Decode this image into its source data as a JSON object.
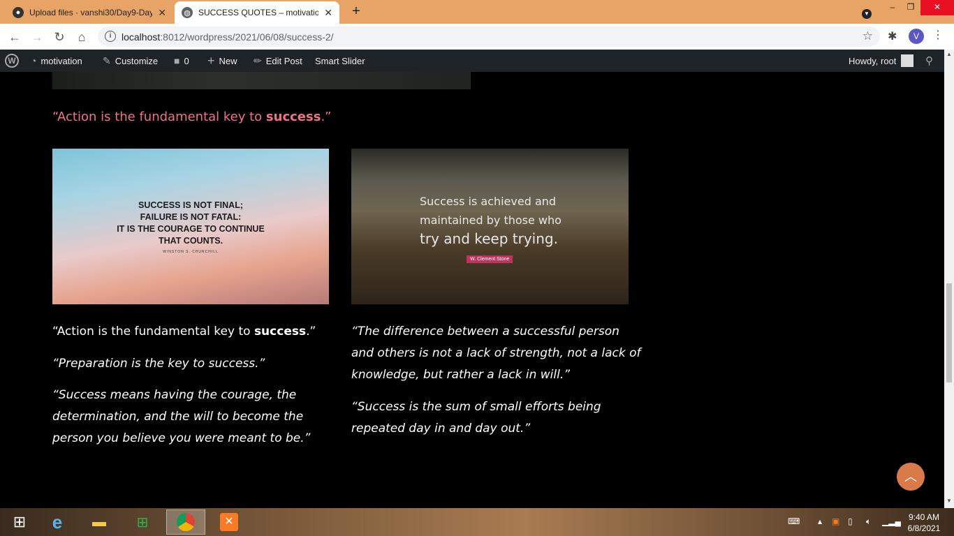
{
  "browser": {
    "tabs": [
      {
        "title": "Upload files · vanshi30/Day9-Day",
        "active": false,
        "icon": "github-icon"
      },
      {
        "title": "SUCCESS QUOTES – motivation",
        "active": true,
        "icon": "globe-icon"
      }
    ],
    "url_host": "localhost",
    "url_path": ":8012/wordpress/2021/06/08/success-2/",
    "profile_initial": "V"
  },
  "wp_admin_bar": {
    "site": "motivation",
    "customize": "Customize",
    "comments": "0",
    "new": "New",
    "edit_post": "Edit Post",
    "smart_slider": "Smart Slider",
    "howdy": "Howdy, root"
  },
  "post": {
    "pink_quote_pre": "“Action is the fundamental key to ",
    "pink_quote_bold": "success",
    "pink_quote_post": ".”",
    "image1": {
      "quote_lines": [
        "SUCCESS IS NOT FINAL;",
        "FAILURE IS NOT FATAL:",
        "IT IS THE COURAGE TO CONTINUE",
        "THAT COUNTS."
      ],
      "author": "WINSTON S. CHURCHILL"
    },
    "image2": {
      "quote_lines": [
        "Success is achieved and",
        "maintained by those who",
        "try and keep trying."
      ],
      "author": "W. Clement Stone"
    },
    "left_col": {
      "q1_pre": "“Action is the fundamental key to ",
      "q1_bold": "success",
      "q1_post": ".”",
      "q2": "“Preparation is the key to success.”",
      "q3_lines": [
        "“Success means having the courage, the",
        "determination, and the will to become the",
        "person you believe you were meant to be.”"
      ]
    },
    "right_col": {
      "q1_lines": [
        "“The difference between a successful person",
        "and others is not a lack of strength, not a lack of",
        "knowledge, but rather a lack in will.”"
      ],
      "q2_lines": [
        "“Success is the sum of small efforts being",
        "repeated day in and day out.”"
      ]
    }
  },
  "taskbar": {
    "time": "9:40 AM",
    "date": "6/8/2021"
  },
  "colors": {
    "accent_pink": "#f0718a",
    "scroll_top": "#d97a4b"
  }
}
